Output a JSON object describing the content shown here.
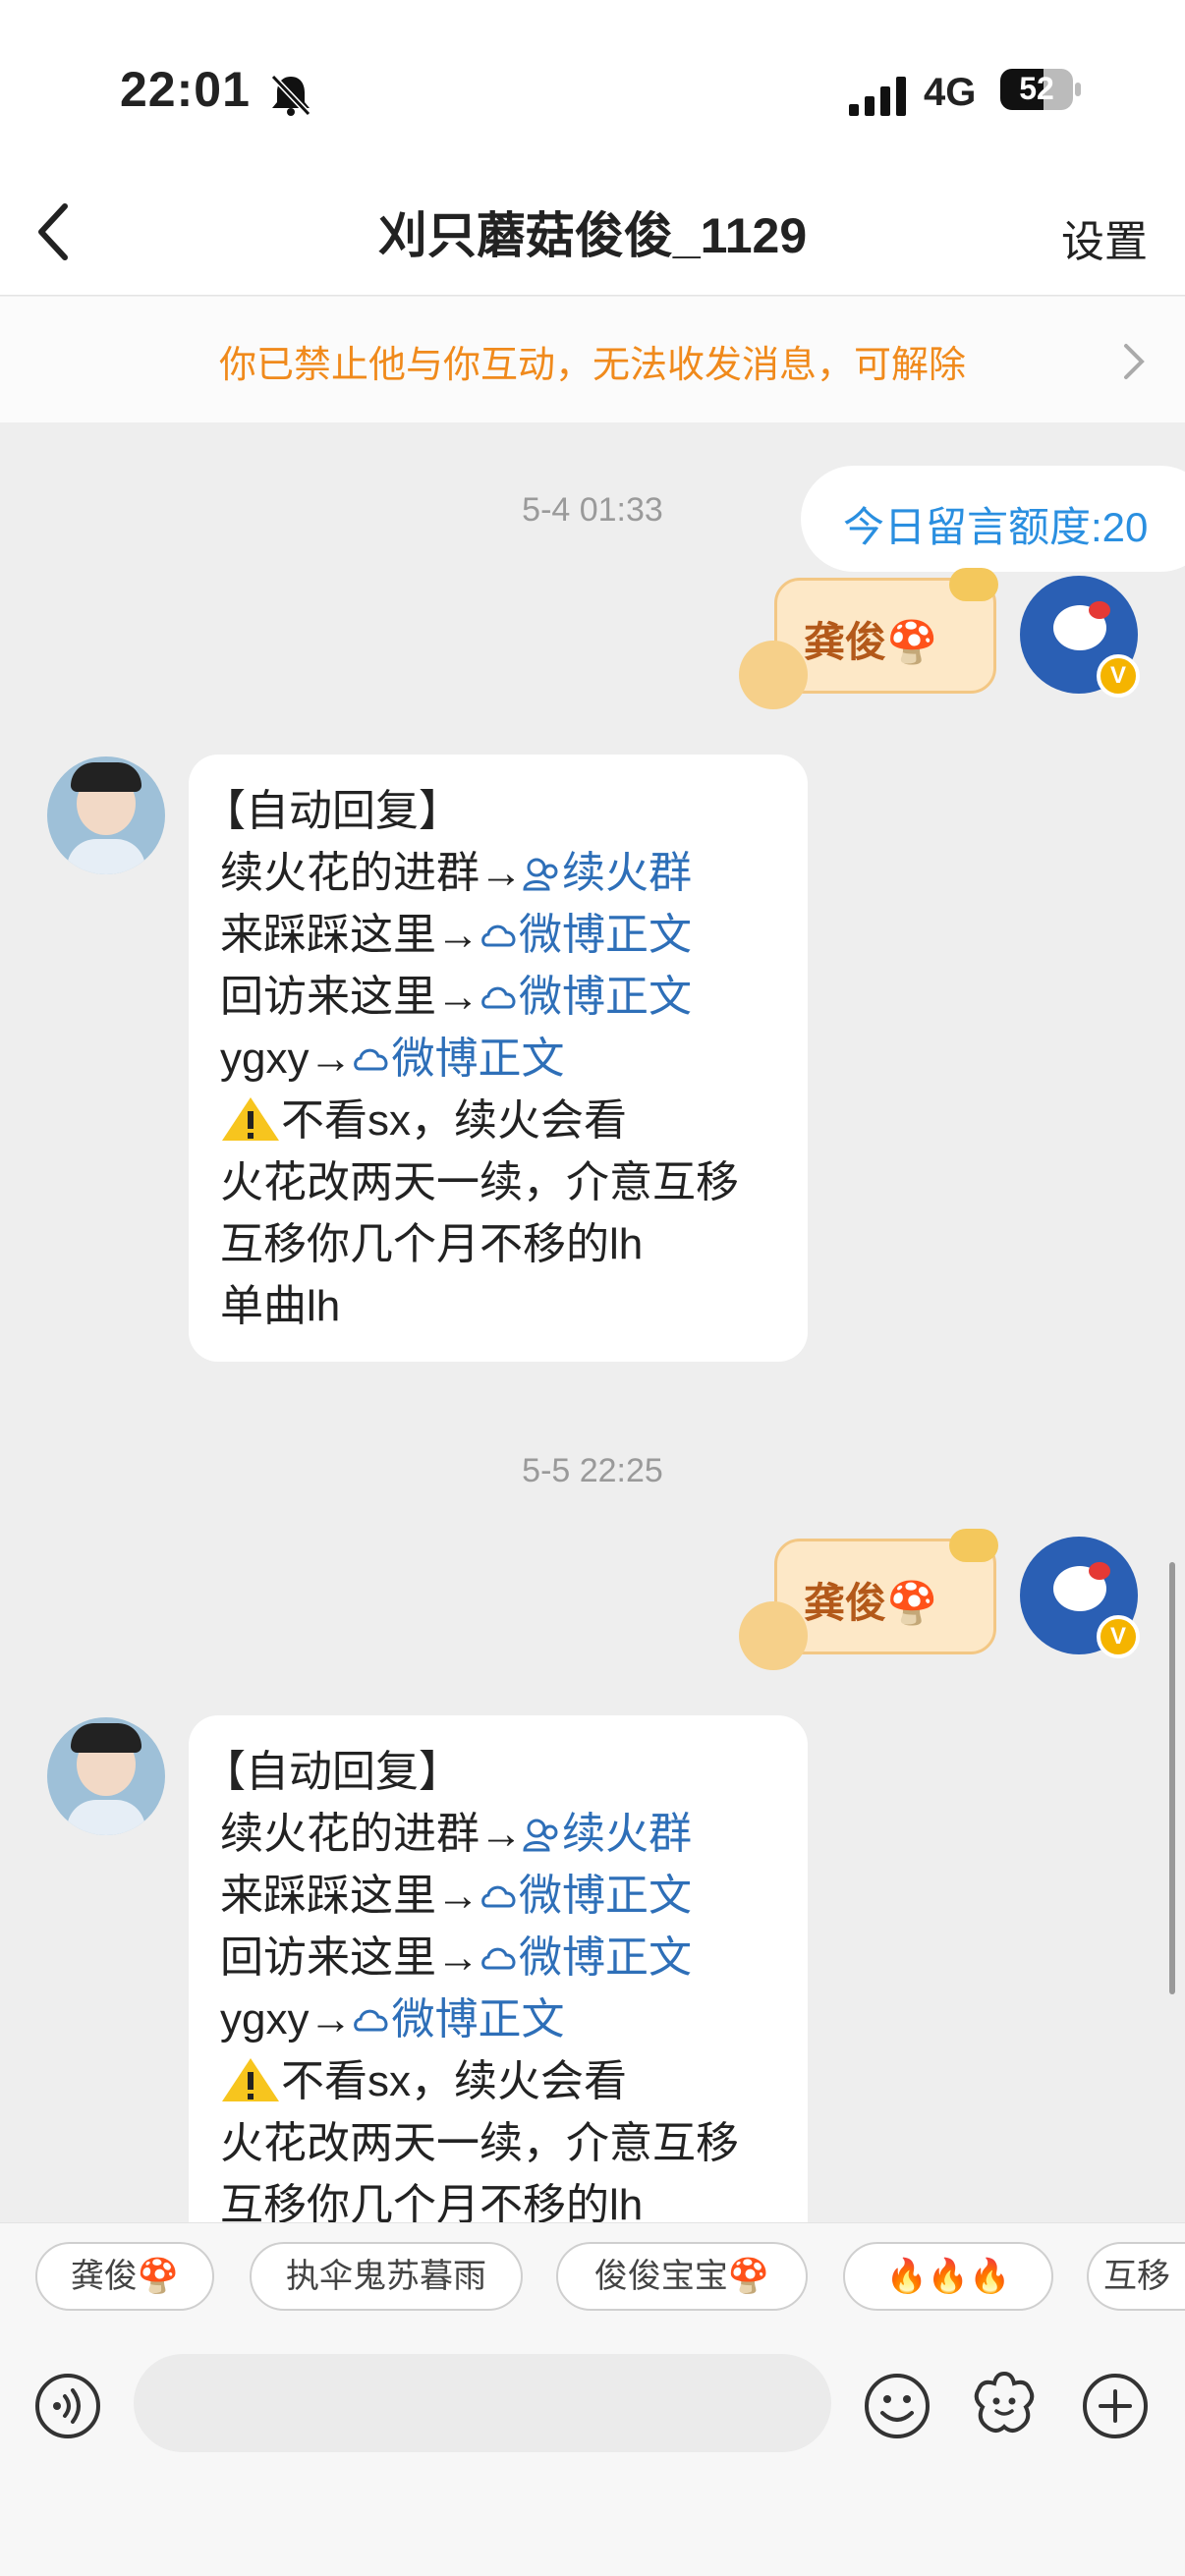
{
  "status_bar": {
    "time": "22:01",
    "network": "4G",
    "battery": "52"
  },
  "header": {
    "title": "刈只蘑菇俊俊_1129",
    "settings_label": "设置"
  },
  "notice": {
    "text": "你已禁止他与你互动，无法收发消息，可解除"
  },
  "quota": {
    "text": "今日留言额度:20"
  },
  "messages": [
    {
      "timestamp": "5-4 01:33",
      "outgoing": "龚俊🍄"
    },
    {
      "timestamp": "5-5 22:25",
      "outgoing": "龚俊🍄"
    }
  ],
  "auto_reply": {
    "header": "【自动回复】",
    "l1": "续火花的进群→",
    "l1_link": "续火群",
    "l2": "来踩踩这里→",
    "l2_link": "微博正文",
    "l3": "回访来这里→",
    "l3_link": "微博正文",
    "l4": "ygxy→",
    "l4_link": "微博正文",
    "l5": "不看sx，续火会看",
    "l6": "火花改两天一续，介意互移",
    "l7": "互移你几个月不移的lh",
    "l8": "单曲lh"
  },
  "quick_replies": [
    "龚俊🍄",
    "执伞鬼苏暮雨",
    "俊俊宝宝🍄",
    "🔥🔥🔥",
    "互移"
  ],
  "icons": {
    "back": "chevron-left-icon",
    "notice_arrow": "chevron-right-icon",
    "voice": "voice-icon",
    "emoji": "emoji-icon",
    "sticker": "sticker-icon",
    "add": "plus-icon",
    "warning": "warning-icon"
  },
  "colors": {
    "notice": "#f08a1c",
    "link": "#2e6fb8",
    "quota": "#2a8fe0"
  }
}
